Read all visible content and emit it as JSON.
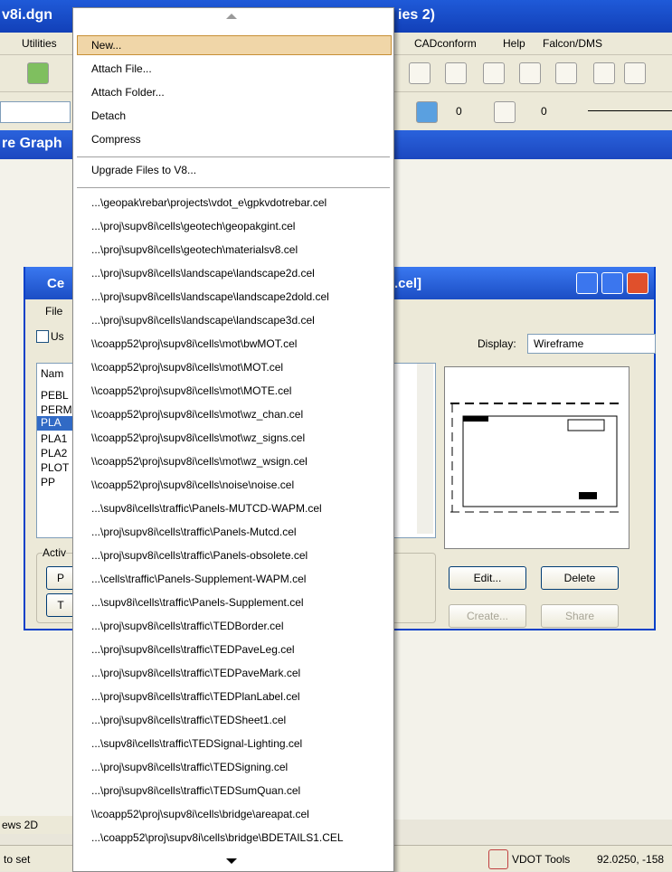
{
  "window": {
    "title_left": "v8i.dgn",
    "title_right": "ies 2)"
  },
  "menubar": {
    "utilities": "Utilities",
    "cadconform": "CADconform",
    "help": "Help",
    "falcon": "Falcon/DMS"
  },
  "toolbar2": {
    "value1": "0",
    "value2": "0"
  },
  "panel": {
    "title_left": "re Graph"
  },
  "dialog": {
    "title_left": "Ce",
    "title_right": ".cel]",
    "menu_file": "File",
    "use_label": "Us",
    "display_label": "Display:",
    "display_value": "Wireframe",
    "list_header": "Nam",
    "list_items": [
      "PEBL",
      "PERM",
      "PLA",
      "PLA1",
      "PLA2",
      "PLOT",
      "PP"
    ],
    "active_label": "Activ",
    "btn_p": "P",
    "btn_t": "T",
    "edit_button": "Edit...",
    "delete_button": "Delete",
    "create_button": "Create...",
    "share_button": "Share"
  },
  "menu": {
    "items": [
      "New...",
      "Attach File...",
      "Attach Folder...",
      "Detach",
      "Compress",
      "Upgrade Files to V8...",
      "...\\geopak\\rebar\\projects\\vdot_e\\gpkvdotrebar.cel",
      "...\\proj\\supv8i\\cells\\geotech\\geopakgint.cel",
      "...\\proj\\supv8i\\cells\\geotech\\materialsv8.cel",
      "...\\proj\\supv8i\\cells\\landscape\\landscape2d.cel",
      "...\\proj\\supv8i\\cells\\landscape\\landscape2dold.cel",
      "...\\proj\\supv8i\\cells\\landscape\\landscape3d.cel",
      "\\\\coapp52\\proj\\supv8i\\cells\\mot\\bwMOT.cel",
      "\\\\coapp52\\proj\\supv8i\\cells\\mot\\MOT.cel",
      "\\\\coapp52\\proj\\supv8i\\cells\\mot\\MOTE.cel",
      "\\\\coapp52\\proj\\supv8i\\cells\\mot\\wz_chan.cel",
      "\\\\coapp52\\proj\\supv8i\\cells\\mot\\wz_signs.cel",
      "\\\\coapp52\\proj\\supv8i\\cells\\mot\\wz_wsign.cel",
      "\\\\coapp52\\proj\\supv8i\\cells\\noise\\noise.cel",
      "...\\supv8i\\cells\\traffic\\Panels-MUTCD-WAPM.cel",
      "...\\proj\\supv8i\\cells\\traffic\\Panels-Mutcd.cel",
      "...\\proj\\supv8i\\cells\\traffic\\Panels-obsolete.cel",
      "...\\cells\\traffic\\Panels-Supplement-WAPM.cel",
      "...\\supv8i\\cells\\traffic\\Panels-Supplement.cel",
      "...\\proj\\supv8i\\cells\\traffic\\TEDBorder.cel",
      "...\\proj\\supv8i\\cells\\traffic\\TEDPaveLeg.cel",
      "...\\proj\\supv8i\\cells\\traffic\\TEDPaveMark.cel",
      "...\\proj\\supv8i\\cells\\traffic\\TEDPlanLabel.cel",
      "...\\proj\\supv8i\\cells\\traffic\\TEDSheet1.cel",
      "...\\supv8i\\cells\\traffic\\TEDSignal-Lighting.cel",
      "...\\proj\\supv8i\\cells\\traffic\\TEDSigning.cel",
      "...\\proj\\supv8i\\cells\\traffic\\TEDSumQuan.cel",
      "\\\\coapp52\\proj\\supv8i\\cells\\bridge\\areapat.cel",
      "...\\coapp52\\proj\\supv8i\\cells\\bridge\\BDETAILS1.CEL"
    ]
  },
  "bottom": {
    "views": "ews 2D",
    "status_left": "to set",
    "vdot_tools": "VDOT Tools",
    "coords": "92.0250, -158"
  },
  "colors": {
    "titlebar": "#1f5ad8",
    "highlight": "#f0d6a8",
    "close": "#e0502c"
  }
}
